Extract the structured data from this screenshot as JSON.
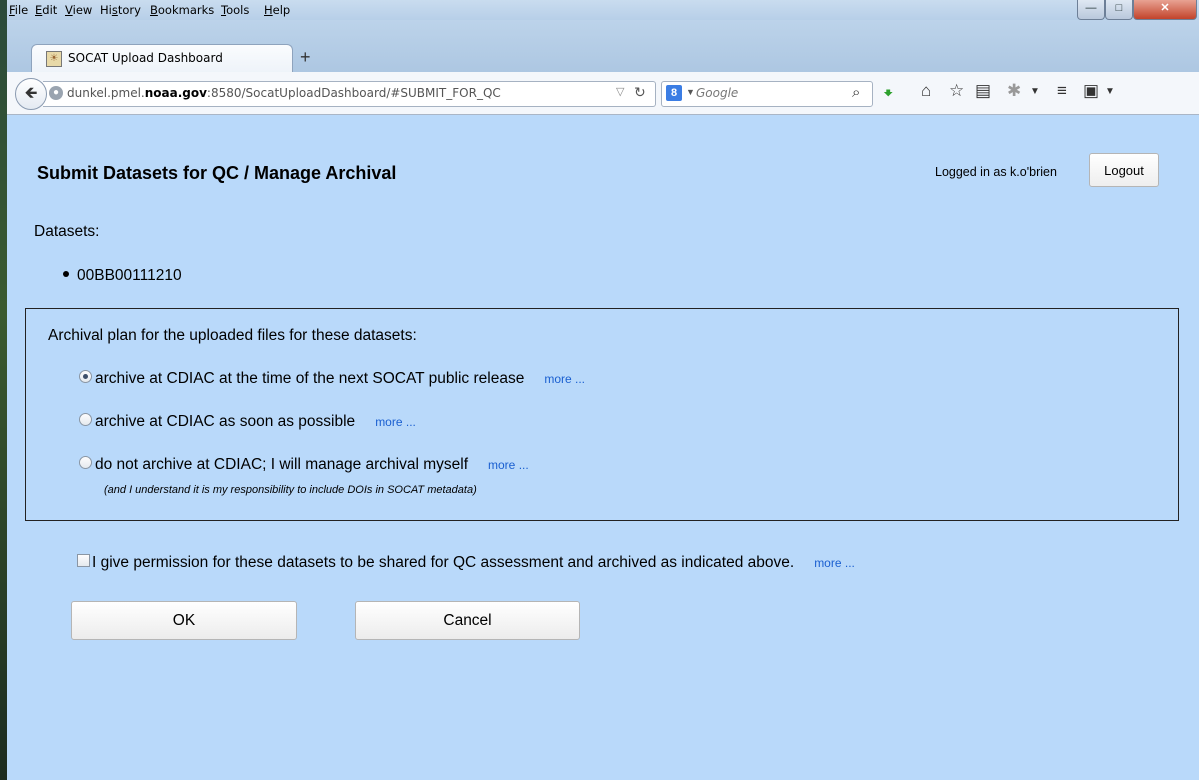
{
  "menu": [
    {
      "pre": "",
      "u": "F",
      "post": "ile"
    },
    {
      "pre": "",
      "u": "E",
      "post": "dit"
    },
    {
      "pre": "",
      "u": "V",
      "post": "iew"
    },
    {
      "pre": "Hi",
      "u": "s",
      "post": "tory"
    },
    {
      "pre": "",
      "u": "B",
      "post": "ookmarks"
    },
    {
      "pre": "",
      "u": "T",
      "post": "ools"
    },
    {
      "pre": "",
      "u": "H",
      "post": "elp"
    }
  ],
  "tab": {
    "title": "SOCAT Upload Dashboard",
    "new_tab": "+"
  },
  "url": {
    "prefix": "dunkel.pmel.",
    "domain": "noaa.gov",
    "suffix": ":8580/SocatUploadDashboard/#SUBMIT_FOR_QC"
  },
  "search": {
    "engine": "8",
    "placeholder": "Google"
  },
  "page": {
    "title": "Submit Datasets for QC / Manage Archival",
    "logged_in": "Logged in as k.o'brien",
    "logout": "Logout",
    "datasets_label": "Datasets:",
    "datasets": [
      "00BB00111210"
    ],
    "archival_label": "Archival plan for the uploaded files for these datasets:",
    "options": [
      {
        "label": "archive at CDIAC at the time of the next SOCAT public release",
        "more": "more ...",
        "checked": true
      },
      {
        "label": "archive at CDIAC as soon as possible",
        "more": "more ...",
        "checked": false
      },
      {
        "label": "do not archive at CDIAC; I will manage archival myself",
        "more": "more ...",
        "checked": false
      }
    ],
    "option_note": "(and I understand it is my responsibility to include DOIs in SOCAT metadata)",
    "permission": "I give permission for these datasets to be shared for QC assessment and archived as indicated above.",
    "permission_more": "more ...",
    "permission_checked": false,
    "ok": "OK",
    "cancel": "Cancel"
  },
  "colors": {
    "content_bg": "#b9d9fa",
    "link": "#1a5fd0"
  }
}
